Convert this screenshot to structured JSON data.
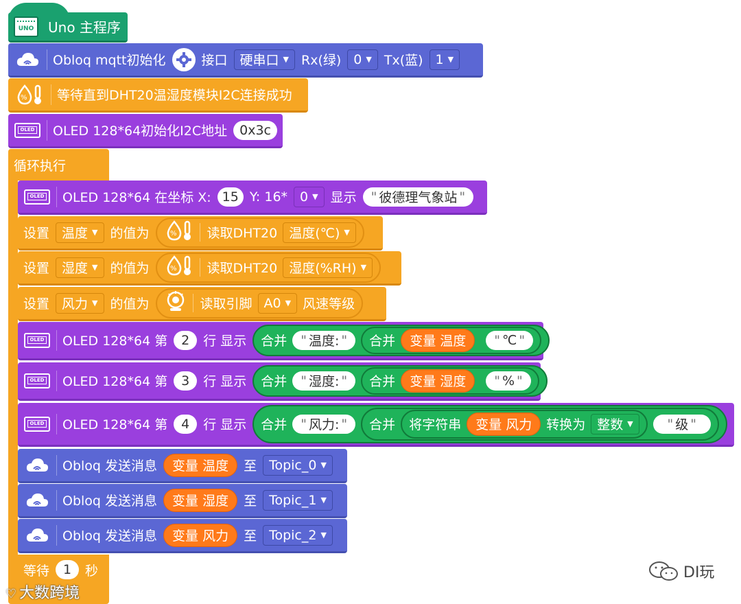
{
  "hat": {
    "label": "Uno 主程序",
    "icon": "uno-board-icon",
    "icon_text": "UNO"
  },
  "blocks": {
    "obloq_init": {
      "label": "Obloq mqtt初始化",
      "port_label": "接口",
      "port": "硬串口",
      "rx_label": "Rx(绿)",
      "rx": "0",
      "tx_label": "Tx(蓝)",
      "tx": "1"
    },
    "dht_wait": {
      "label": "等待直到DHT20温湿度模块I2C连接成功"
    },
    "oled_init": {
      "label": "OLED 128*64初始化I2C地址",
      "addr": "0x3c"
    },
    "loop": {
      "label": "循环执行"
    },
    "oled_show": {
      "label": "OLED 128*64 在坐标 X:",
      "x": "15",
      "y_label": "Y: 16*",
      "y": "0",
      "show_label": "显示",
      "text": "彼德理气象站"
    },
    "set_temp": {
      "set": "设置",
      "var": "温度",
      "value_label": "的值为",
      "read": "读取DHT20",
      "option": "温度(℃)"
    },
    "set_hum": {
      "set": "设置",
      "var": "湿度",
      "value_label": "的值为",
      "read": "读取DHT20",
      "option": "湿度(%RH)"
    },
    "set_wind": {
      "set": "设置",
      "var": "风力",
      "value_label": "的值为",
      "read": "读取引脚",
      "pin": "A0",
      "suffix": "风速等级"
    },
    "line2": {
      "label": "OLED 128*64 第",
      "line": "2",
      "row_label": "行 显示",
      "join": "合并",
      "str1": "温度:",
      "join2": "合并",
      "var": "变量 温度",
      "str2": "℃"
    },
    "line3": {
      "label": "OLED 128*64 第",
      "line": "3",
      "row_label": "行 显示",
      "join": "合并",
      "str1": "湿度:",
      "join2": "合并",
      "var": "变量 湿度",
      "str2": "%"
    },
    "line4": {
      "label": "OLED 128*64 第",
      "line": "4",
      "row_label": "行 显示",
      "join": "合并",
      "str1": "风力:",
      "join2": "合并",
      "convert": "将字符串",
      "var": "变量 风力",
      "to": "转换为",
      "type": "整数",
      "str2": "级"
    },
    "send0": {
      "label": "Obloq 发送消息",
      "var": "变量 温度",
      "to": "至",
      "topic": "Topic_0"
    },
    "send1": {
      "label": "Obloq 发送消息",
      "var": "变量 湿度",
      "to": "至",
      "topic": "Topic_1"
    },
    "send2": {
      "label": "Obloq 发送消息",
      "var": "变量 风力",
      "to": "至",
      "topic": "Topic_2"
    },
    "wait": {
      "label": "等待",
      "value": "1",
      "unit": "秒"
    }
  },
  "watermarks": {
    "left": "大数跨境",
    "right": "DI玩"
  },
  "icons": {
    "cloud": "cloud-wifi-icon",
    "oled": "oled-screen-icon",
    "oled_text": "OLED",
    "dht": "humidity-thermometer-icon",
    "wind": "wind-sensor-icon",
    "gear": "gear-icon"
  },
  "colors": {
    "hat": "#1aa16f",
    "blue": "#5b67d4",
    "purple": "#9a3fde",
    "orange": "#f6a623",
    "green": "#1fb35a",
    "variable": "#ff7a1a"
  }
}
